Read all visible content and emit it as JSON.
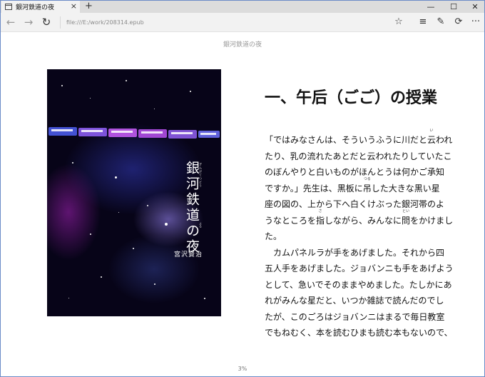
{
  "window": {
    "tab_title": "銀河鉄道の夜",
    "tab_close": "×",
    "new_tab": "+",
    "minimize": "—",
    "maximize": "☐",
    "close": "✕"
  },
  "nav": {
    "back": "←",
    "forward": "→",
    "refresh": "↻",
    "address": "file:///E:/work/208314.epub",
    "favorite": "☆",
    "hub": "≡",
    "note": "✎",
    "share": "⟳",
    "more": "···"
  },
  "icons": {
    "tab": "page-icon",
    "back": "arrow-left-icon",
    "forward": "arrow-right-icon",
    "refresh": "refresh-icon",
    "favorite": "star-icon",
    "hub": "hub-icon",
    "note": "web-note-icon",
    "share": "share-icon",
    "more": "more-icon"
  },
  "reader": {
    "book_title": "銀河鉄道の夜",
    "chapter_title": "一、午后（ごご）の授業",
    "progress": "3%"
  },
  "cover": {
    "title": "銀河鉄道の夜",
    "title_ruby": "ぎんがてつどう",
    "title_ruby_2": "よる",
    "author": "宮沢賢治"
  },
  "text": {
    "l1a": "「ではみなさんは、そういうふうに川だと",
    "l1_rb": "云",
    "l1_rt": "い",
    "l1b": "われ",
    "l2": "たり、乳の流れたあとだと云われたりしていたこ",
    "l3": "のぼんやりと白いものがほんとうは何かご承知",
    "l4a": "ですか。」先生は、黒板に",
    "l4_rb": "吊",
    "l4_rt": "つる",
    "l4b": "した大きな黒い星",
    "l5": "座の図の、上から下へ白くけぶった銀河帯のよ",
    "l6a": "うなところを",
    "l6_rb": "指",
    "l6_rt": "さ",
    "l6b": "しながら、みんなに",
    "l6_rb2": "問",
    "l6_rt2": "とい",
    "l6c": "をかけまし",
    "l7": "た。",
    "l8": "　カムパネルラが手をあげました。それから四",
    "l9": "五人手をあげました。ジョバンニも手をあげよう",
    "l10": "として、急いでそのままやめました。たしかにあ",
    "l11": "れがみんな星だと、いつか雑誌で読んだのでし",
    "l12": "たが、このごろはジョバンニはまるで毎日教室",
    "l13": "でもねむく、本を読むひまも読む本もないので、"
  }
}
